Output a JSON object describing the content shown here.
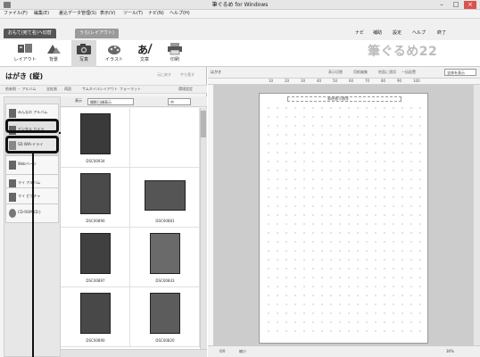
{
  "window": {
    "title": "筆ぐるめ for Windows",
    "controls": [
      "–",
      "□",
      "×"
    ]
  },
  "menubar": {
    "items": [
      "ファイル(F)",
      "編集(E)",
      "差込データ管理(S)",
      "表示(V)",
      "ツール(T)",
      "ナビ(N)",
      "ヘルプ(H)"
    ]
  },
  "tabs": {
    "items": [
      {
        "label": "おもて(宛て名)へ切替",
        "active": true
      },
      {
        "label": "うら(レイアウト)",
        "active": false
      }
    ],
    "help_links": [
      "ナビ",
      "補助",
      "設定",
      "ヘルプ",
      "終了"
    ]
  },
  "toolbar": {
    "tools": [
      {
        "label": "レイアウト",
        "icon": "layout-icon",
        "selected": false
      },
      {
        "label": "背景",
        "icon": "background-icon",
        "selected": false
      },
      {
        "label": "写真",
        "icon": "photo-icon",
        "selected": true
      },
      {
        "label": "イラスト",
        "icon": "illustration-icon",
        "selected": false
      },
      {
        "label": "文章",
        "icon": "text-icon",
        "selected": false
      },
      {
        "label": "印刷",
        "icon": "printer-icon",
        "selected": false
      }
    ],
    "brand": "筆ぐるめ22"
  },
  "leftpanel": {
    "title": "はがき (縦)",
    "undo_label": "元に戻す",
    "redo_label": "やり直す",
    "subnav": [
      "他参照 ・ アルバム",
      "全拡張",
      "再読",
      "サムネイルレイアウト",
      "フォーマット",
      "環境設定"
    ],
    "sources": [
      {
        "label": "みんなの アルバム"
      },
      {
        "label": "デジタル カメラ"
      },
      {
        "label": "SD WIA-ドライ"
      },
      {
        "label": "Webページ"
      },
      {
        "label": "マイ アルバム"
      },
      {
        "label": "マイ ピクチャ"
      },
      {
        "label": "CD-ROM (D:)"
      }
    ],
    "view_label": "表示",
    "view_select": "撮影日順表示",
    "thumb_size": "中",
    "photos": [
      {
        "name": "DSC00934"
      },
      {
        "name": ""
      },
      {
        "name": "DSC00890"
      },
      {
        "name": "DSC00881"
      },
      {
        "name": "DSC00897"
      },
      {
        "name": "DSC00843"
      },
      {
        "name": "DSC00890"
      },
      {
        "name": "DSC00820"
      }
    ]
  },
  "rightpanel": {
    "header_left": "はがき",
    "header_items": [
      "表示切替",
      "用紙編集",
      "他面に適用",
      "一括配置"
    ],
    "layout_select": "全体を表示",
    "ruler_marks": [
      "10",
      "20",
      "30",
      "40",
      "50",
      "60",
      "70",
      "80",
      "90",
      "100"
    ],
    "postal_label": "郵便番号欄等",
    "status_page": "0/0",
    "status_zoom": "縮小",
    "status_right": "36%"
  }
}
